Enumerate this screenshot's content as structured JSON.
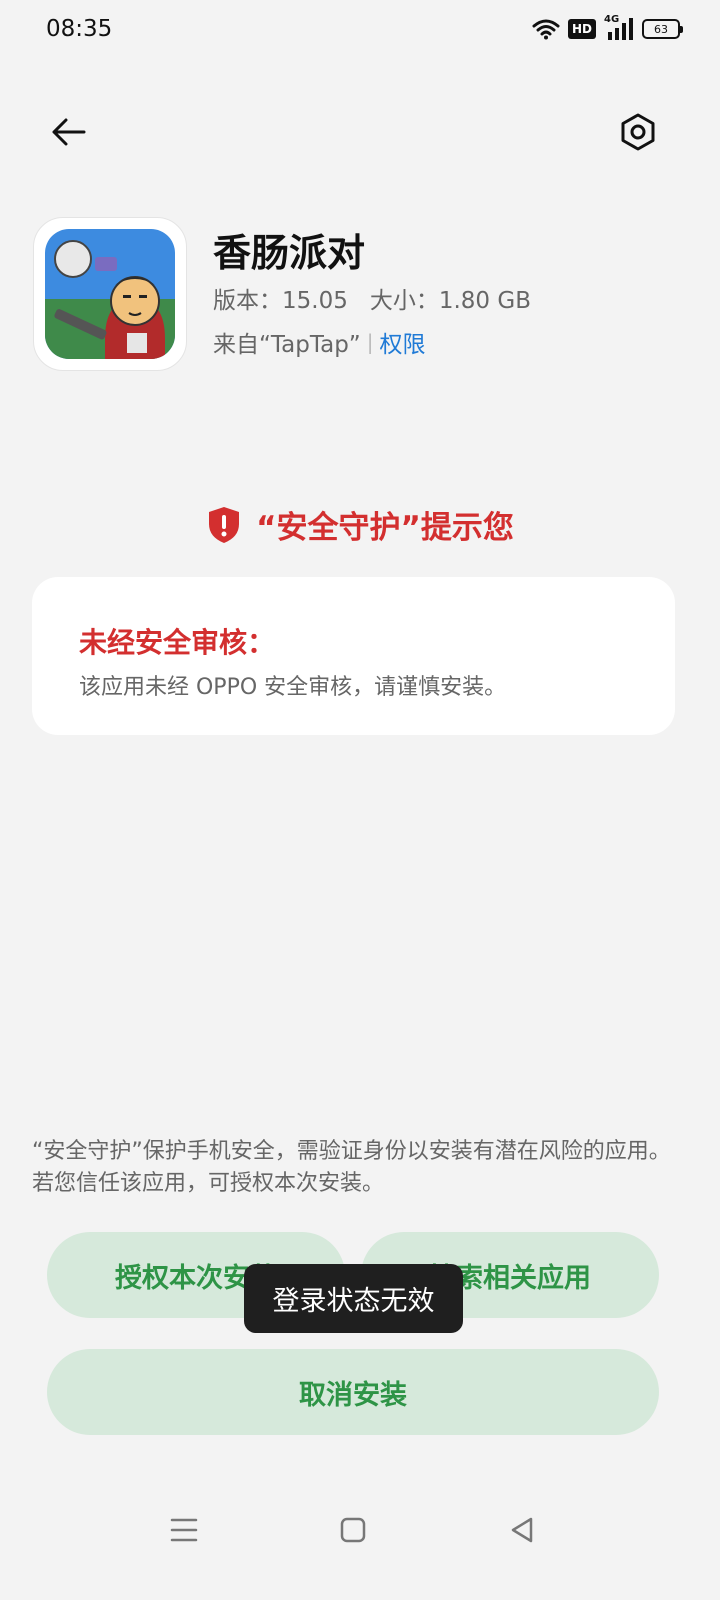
{
  "status_bar": {
    "time": "08:35",
    "hd_label": "HD",
    "network_label": "4G",
    "battery_level": "63"
  },
  "header": {
    "back_icon": "arrow-left-icon",
    "settings_icon": "hexagon-gear-icon"
  },
  "app": {
    "name": "香肠派对",
    "version": "版本：15.05",
    "size": "大小：1.80 GB",
    "source": "来自“TapTap”",
    "permissions_link": "权限"
  },
  "warning": {
    "title": "“安全守护”提示您",
    "shield_color": "#d32f2f",
    "card_title": "未经安全审核：",
    "card_body": "该应用未经 OPPO 安全审核，请谨慎安装。"
  },
  "footer_note": "“安全守护”保护手机安全，需验证身份以安装有潜在风险的应用。若您信任该应用，可授权本次安装。",
  "buttons": {
    "authorize": "授权本次安装",
    "search_related": "搜索相关应用",
    "cancel": "取消安装"
  },
  "toast": "登录状态无效",
  "colors": {
    "accent_green": "#2e9446",
    "button_bg": "#d6e9db",
    "warning_red": "#d32f2f",
    "link_blue": "#1f7ad6"
  },
  "nav_bar": {
    "menu_icon": "menu-lines-icon",
    "home_icon": "square-home-icon",
    "back_icon": "triangle-back-icon"
  }
}
